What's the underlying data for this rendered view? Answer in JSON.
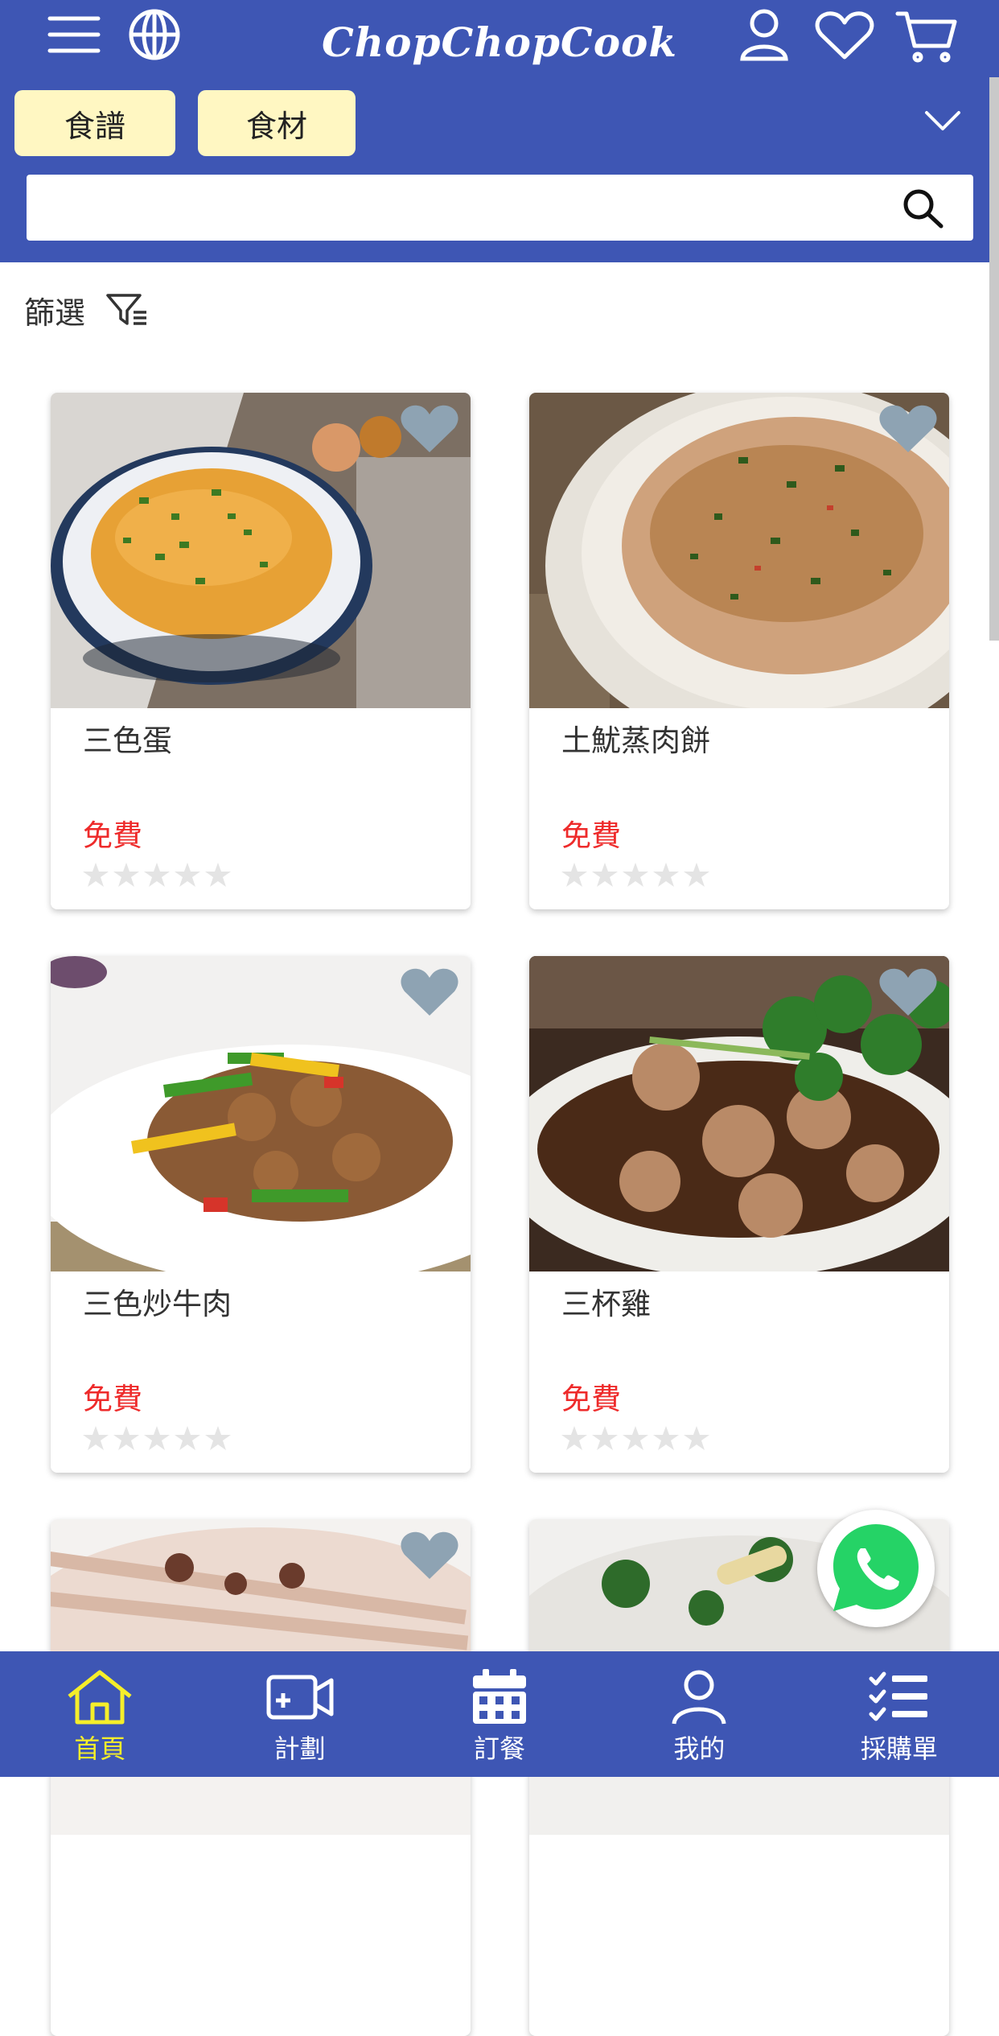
{
  "header": {
    "brand": "ChopChopCook",
    "tabs": [
      {
        "label": "食譜"
      },
      {
        "label": "食材"
      }
    ],
    "search_value": "",
    "search_placeholder": ""
  },
  "filter": {
    "label": "篩選"
  },
  "cards": [
    {
      "name": "三色蛋",
      "price": "免費",
      "rating": 0
    },
    {
      "name": "土魷蒸肉餅",
      "price": "免費",
      "rating": 0
    },
    {
      "name": "三色炒牛肉",
      "price": "免費",
      "rating": 0
    },
    {
      "name": "三杯雞",
      "price": "免費",
      "rating": 0
    },
    {
      "name": "",
      "price": "",
      "rating": 0
    },
    {
      "name": "",
      "price": "",
      "rating": 0
    }
  ],
  "bottom_nav": [
    {
      "label": "首頁",
      "icon": "home-icon",
      "active": true
    },
    {
      "label": "計劃",
      "icon": "video-plan-icon",
      "active": false
    },
    {
      "label": "訂餐",
      "icon": "calendar-icon",
      "active": false
    },
    {
      "label": "我的",
      "icon": "user-icon",
      "active": false
    },
    {
      "label": "採購單",
      "icon": "checklist-icon",
      "active": false
    }
  ],
  "colors": {
    "primary": "#3e56b4",
    "tab_bg": "#fff7c2",
    "price": "#ee2b2b",
    "active_nav": "#f5ee2a",
    "fav_heart": "#8ea3b3",
    "whatsapp": "#25d366"
  }
}
